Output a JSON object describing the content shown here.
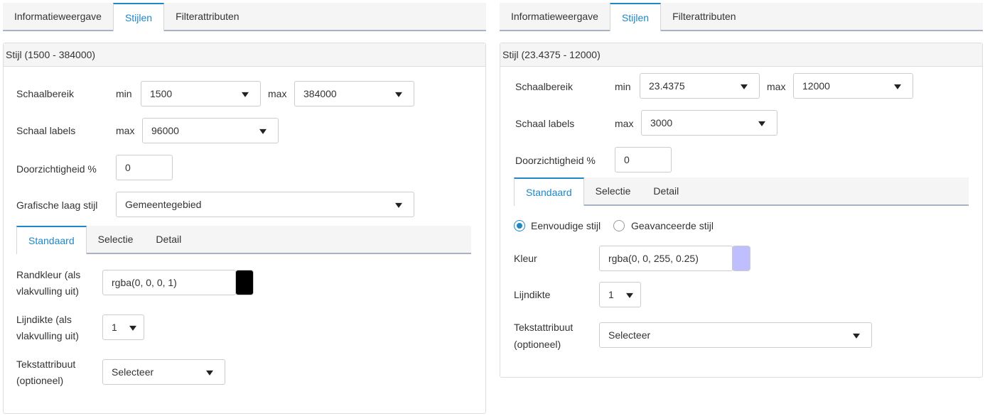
{
  "left": {
    "tabs": [
      "Informatieweergave",
      "Stijlen",
      "Filterattributen"
    ],
    "header": "Stijl (1500 - 384000)",
    "scale_range": {
      "label": "Schaalbereik",
      "min_label": "min",
      "min_value": "1500",
      "max_label": "max",
      "max_value": "384000"
    },
    "scale_labels": {
      "label": "Schaal labels",
      "max_label": "max",
      "max_value": "96000"
    },
    "transparency": {
      "label": "Doorzichtigheid %",
      "value": "0"
    },
    "graphic_style": {
      "label": "Grafische laag stijl",
      "value": "Gemeentegebied"
    },
    "subtabs": [
      "Standaard",
      "Selectie",
      "Detail"
    ],
    "border_color": {
      "label_line1": "Randkleur (als",
      "label_line2": "vlakvulling uit)",
      "value": "rgba(0, 0, 0, 1)",
      "swatch_color": "#000000"
    },
    "line_width": {
      "label_line1": "Lijndikte (als",
      "label_line2": "vlakvulling uit)",
      "value": "1"
    },
    "text_attr": {
      "label_line1": "Tekstattribuut",
      "label_line2": "(optioneel)",
      "value": "Selecteer"
    }
  },
  "right": {
    "tabs": [
      "Informatieweergave",
      "Stijlen",
      "Filterattributen"
    ],
    "header": "Stijl (23.4375 - 12000)",
    "scale_range": {
      "label": "Schaalbereik",
      "min_label": "min",
      "min_value": "23.4375",
      "max_label": "max",
      "max_value": "12000"
    },
    "scale_labels": {
      "label": "Schaal labels",
      "max_label": "max",
      "max_value": "3000"
    },
    "transparency": {
      "label": "Doorzichtigheid %",
      "value": "0"
    },
    "subtabs": [
      "Standaard",
      "Selectie",
      "Detail"
    ],
    "style_mode": {
      "simple": "Eenvoudige stijl",
      "advanced": "Geavanceerde stijl",
      "selected": "simple"
    },
    "color": {
      "label": "Kleur",
      "value": "rgba(0, 0, 255, 0.25)",
      "swatch_color": "#bfbfff"
    },
    "line_width": {
      "label": "Lijndikte",
      "value": "1"
    },
    "text_attr": {
      "label_line1": "Tekstattribuut",
      "label_line2": "(optioneel)",
      "value": "Selecteer"
    }
  },
  "colors": {
    "accent": "#1e87c8",
    "tab_underline": "#a7b3c2",
    "header_bg": "#f5f5f5"
  }
}
